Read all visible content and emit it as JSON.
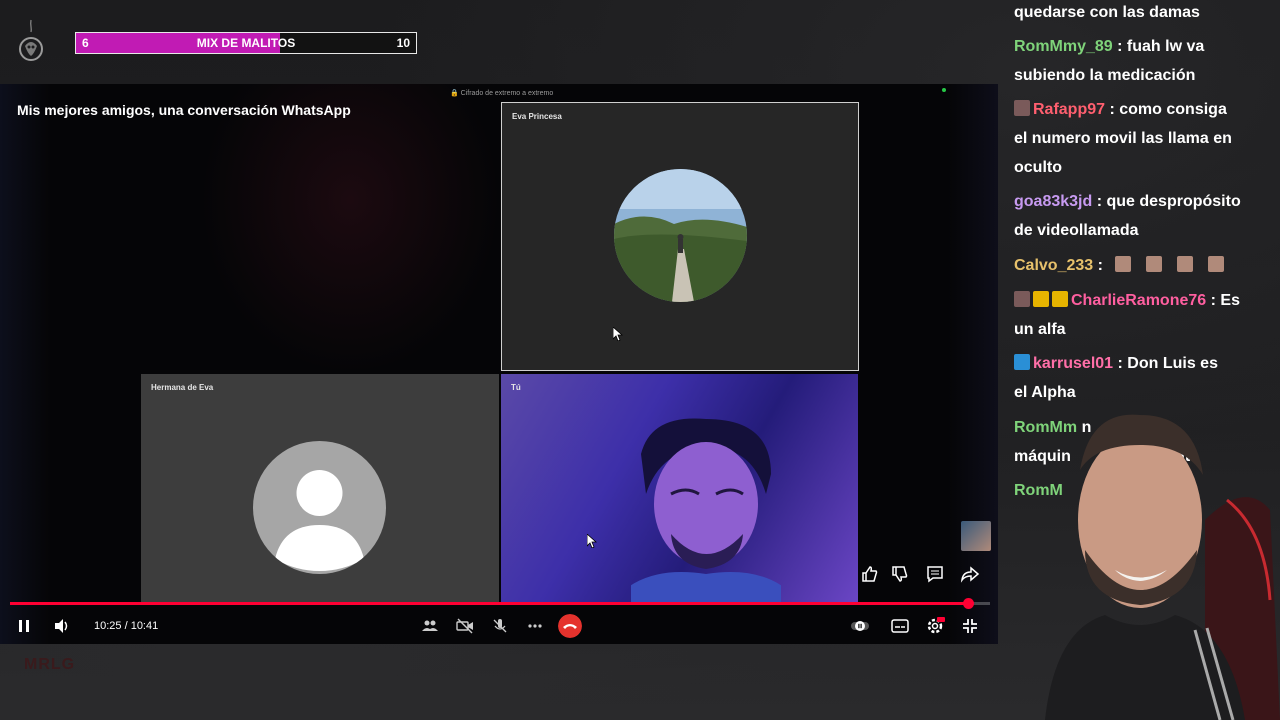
{
  "overlay": {
    "score_left": "6",
    "score_title": "MIX DE MALITOS",
    "score_right": "10",
    "score_progress": 0.6,
    "watermark": "MRLG",
    "accent": "#c11bb4"
  },
  "player": {
    "video_title": "Mis mejores amigos, una conversación WhatsApp",
    "encryption_label": "🔒 Cifrado de extremo a extremo",
    "time_display": "10:25 / 10:41",
    "progress": 0.978,
    "progress_color": "#ff0033",
    "tiles": {
      "eva_name": "Eva Princesa",
      "hermana_name": "Hermana de Eva",
      "tu_name": "Tú"
    },
    "icons": [
      "pause-icon",
      "volume-icon",
      "participants-icon",
      "camera-off-icon",
      "mic-muted-icon",
      "more-icon",
      "end-call-icon",
      "like-icon",
      "dislike-icon",
      "comment-icon",
      "share-icon",
      "autoplay-toggle-icon",
      "subtitles-icon",
      "settings-icon",
      "exit-fullscreen-icon"
    ]
  },
  "chat": {
    "messages": [
      {
        "user": "",
        "user_color": "#ffffff",
        "text": "quedarse con las damas"
      },
      {
        "user": "RomMmy_89",
        "user_color": "#7fd37a",
        "text": ": fuah lw va"
      },
      {
        "user": "",
        "user_color": "#ffffff",
        "text": "subiendo la medicación"
      },
      {
        "user": "Rafapp97",
        "user_color": "#ff5f6f",
        "text": ": como consiga"
      },
      {
        "user": "",
        "user_color": "#ffffff",
        "text": "el numero movil las llama en"
      },
      {
        "user": "",
        "user_color": "#ffffff",
        "text": "oculto"
      },
      {
        "user": "goa83k3jd",
        "user_color": "#c79af0",
        "text": ": que despropósito"
      },
      {
        "user": "",
        "user_color": "#ffffff",
        "text": "de videollamada"
      },
      {
        "user": "Calvo_233",
        "user_color": "#e7c16b",
        "text": ":"
      },
      {
        "user": "CharlieRamone76",
        "user_color": "#ff5fa0",
        "text": ": Es"
      },
      {
        "user": "",
        "user_color": "#ffffff",
        "text": "un alfa"
      },
      {
        "user": "karrusel01",
        "user_color": "#ff6fa8",
        "text": ": Don Luis es"
      },
      {
        "user": "",
        "user_color": "#ffffff",
        "text": "el Alpha"
      },
      {
        "user": "RomMm",
        "user_color": "#7fd37a",
        "text": "n"
      },
      {
        "user": "",
        "user_color": "#ffffff",
        "text": "máquin"
      },
      {
        "user": "",
        "user_color": "#ffffff",
        "text": "ata"
      },
      {
        "user": "RomM",
        "user_color": "#7fd37a",
        "text": ""
      }
    ]
  }
}
